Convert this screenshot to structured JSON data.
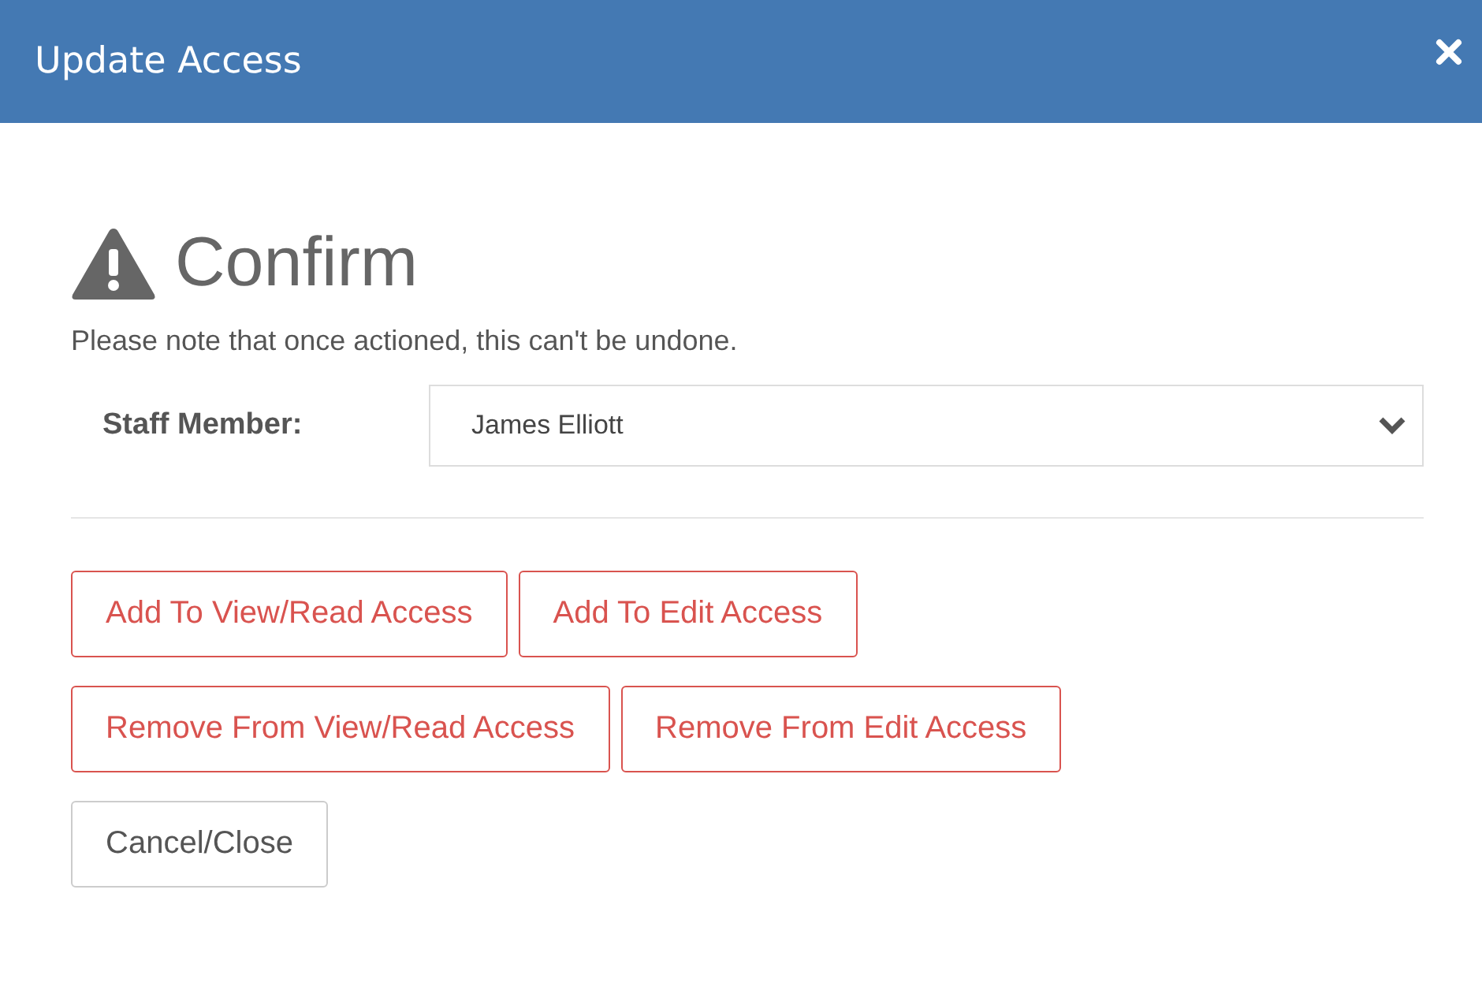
{
  "dialog": {
    "title": "Update Access"
  },
  "heading": "Confirm",
  "note": "Please note that once actioned, this can't be undone.",
  "staff_field": {
    "label": "Staff Member:",
    "value": "James Elliott"
  },
  "button_rows": [
    [
      {
        "label": "Add To View/Read Access",
        "kind": "danger"
      },
      {
        "label": "Add To Edit Access",
        "kind": "danger"
      }
    ],
    [
      {
        "label": "Remove From View/Read Access",
        "kind": "danger"
      },
      {
        "label": "Remove From Edit Access",
        "kind": "danger"
      }
    ],
    [
      {
        "label": "Cancel/Close",
        "kind": "default"
      }
    ]
  ]
}
